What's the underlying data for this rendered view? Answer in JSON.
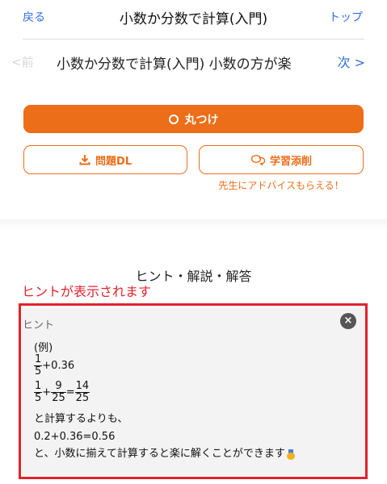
{
  "nav": {
    "back": "戻る",
    "title": "小数か分数で計算(入門)",
    "top": "トップ"
  },
  "sub": {
    "prev": "<前",
    "title": "小数か分数で計算(入門) 小数の方が楽",
    "next": "次 >"
  },
  "buttons": {
    "mark": "丸つけ",
    "dl": "問題DL",
    "review": "学習添削",
    "advice": "先生にアドバイスもらえる！"
  },
  "hint_section": {
    "title": "ヒント・解説・解答",
    "annotation": "ヒントが表示されます"
  },
  "hint": {
    "label": "ヒント",
    "close": "×",
    "example": "(例)",
    "frac1": {
      "num": "1",
      "den": "5"
    },
    "line1_rest": "+0.36",
    "line2": {
      "a": {
        "num": "1",
        "den": "5"
      },
      "plus": "+",
      "b": {
        "num": "9",
        "den": "25"
      },
      "eq": "=",
      "c": {
        "num": "14",
        "den": "25"
      }
    },
    "text1": "と計算するよりも、",
    "text2": "0.2+0.36=0.56",
    "text3": "と、小数に揃えて計算すると楽に解くことができます"
  },
  "colors": {
    "accent": "#ec6e19",
    "link": "#2f6fe0",
    "annotation": "#e3222c"
  }
}
